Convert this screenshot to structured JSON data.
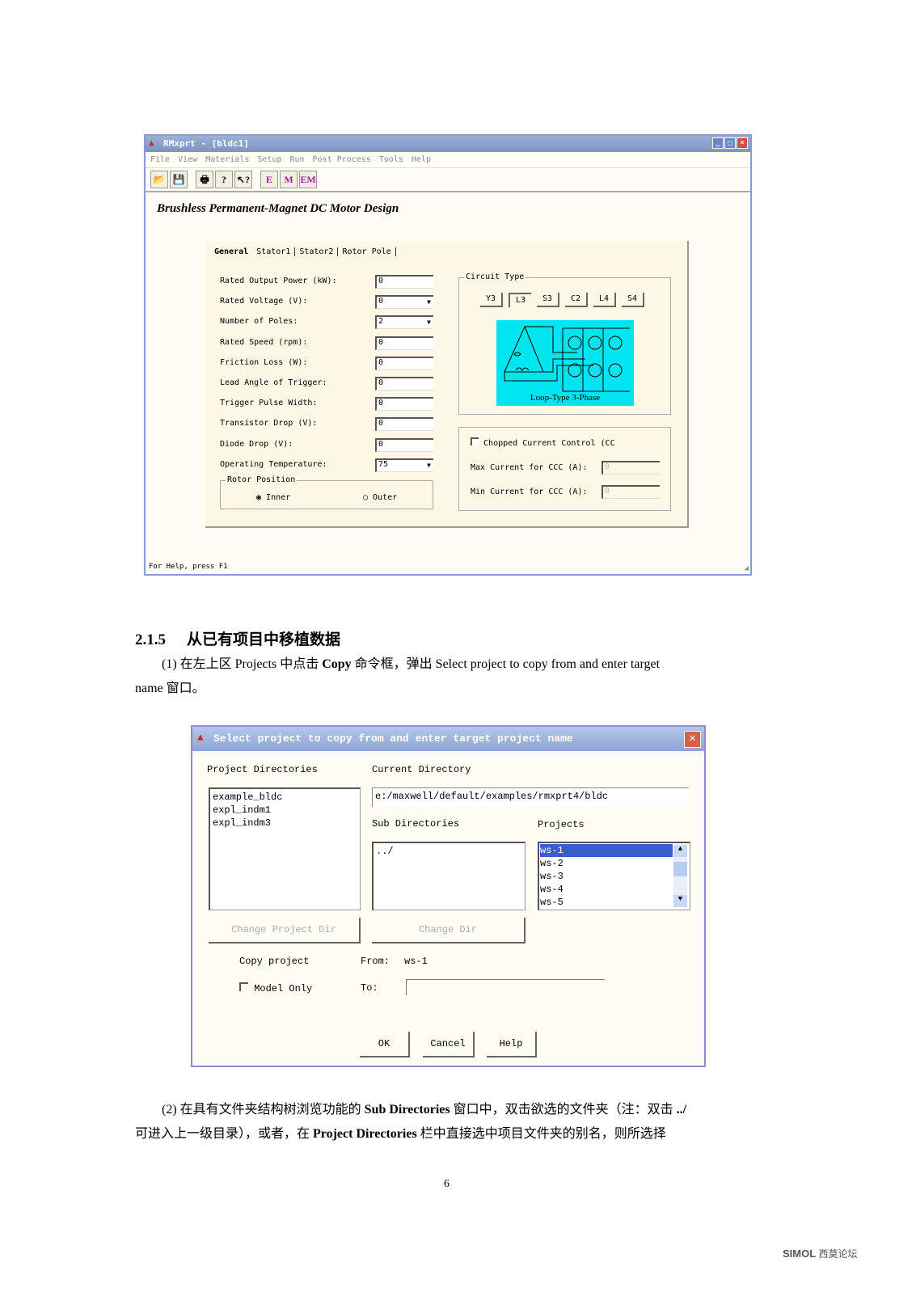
{
  "window1": {
    "title": "RMxprt - [bldc1]",
    "menu": [
      "File",
      "View",
      "Materials",
      "Setup",
      "Run",
      "Post Process",
      "Tools",
      "Help"
    ],
    "toolbar": [
      {
        "icon": "open-icon",
        "g": "📂"
      },
      {
        "icon": "save-icon",
        "g": "💾"
      },
      {
        "icon": "print-icon",
        "g": "🖶"
      },
      {
        "icon": "help-icon",
        "g": "?"
      },
      {
        "icon": "context-help-icon",
        "g": "↖?"
      },
      {
        "icon": "E",
        "g": "E"
      },
      {
        "icon": "M",
        "g": "M"
      },
      {
        "icon": "EM",
        "g": "EM"
      }
    ],
    "heading": "Brushless Permanent-Magnet DC Motor Design",
    "tabs": [
      "General",
      "Stator1",
      "Stator2",
      "Rotor Pole"
    ],
    "fields": [
      {
        "label": "Rated Output Power (kW):",
        "value": "0",
        "dropdown": false
      },
      {
        "label": "Rated Voltage (V):",
        "value": "0",
        "dropdown": true
      },
      {
        "label": "Number of Poles:",
        "value": "2",
        "dropdown": true
      },
      {
        "label": "Rated Speed (rpm):",
        "value": "0",
        "dropdown": false
      },
      {
        "label": "Friction  Loss (W):",
        "value": "0",
        "dropdown": false
      },
      {
        "label": "Lead Angle of Trigger:",
        "value": "0",
        "dropdown": false
      },
      {
        "label": "Trigger Pulse Width:",
        "value": "0",
        "dropdown": false
      },
      {
        "label": "Transistor Drop (V):",
        "value": "0",
        "dropdown": false
      },
      {
        "label": "Diode Drop (V):",
        "value": "0",
        "dropdown": false
      },
      {
        "label": "Operating Temperature:",
        "value": "75",
        "dropdown": true
      }
    ],
    "rotor_position": {
      "label": "Rotor Position",
      "options": [
        "Inner",
        "Outer"
      ],
      "selected": "Inner"
    },
    "circuit_type": {
      "label": "Circuit Type",
      "buttons": [
        "Y3",
        "L3",
        "S3",
        "C2",
        "L4",
        "S4"
      ],
      "selected": "L3",
      "caption": "Loop-Type 3-Phase",
      "color": "#00e5f0"
    },
    "ccc": {
      "checkbox": "Chopped Current Control (CC",
      "checked": false,
      "max_label": "Max Current for CCC (A):",
      "max_value": "0",
      "min_label": "Min Current for CCC (A):",
      "min_value": "0"
    },
    "status": "For Help, press F1"
  },
  "section": {
    "number": "2.1.5",
    "title": "从已有项目中移植数据"
  },
  "para1": {
    "a": "(1) 在左上区 Projects 中点击 ",
    "b": "Copy",
    "c": " 命令框，弹出 Select project to copy from and enter target",
    "d": "name 窗口。"
  },
  "window2": {
    "title": "Select project to copy from and enter target project name",
    "project_dirs_label": "Project Directories",
    "project_dirs": [
      "example_bldc",
      "expl_indm1",
      "expl_indm3"
    ],
    "current_dir_label": "Current Directory",
    "current_dir": "e:/maxwell/default/examples/rmxprt4/bldc",
    "sub_dirs_label": "Sub Directories",
    "sub_dirs": [
      "../"
    ],
    "projects_label": "Projects",
    "projects": [
      "ws-1",
      "ws-2",
      "ws-3",
      "ws-4",
      "ws-5"
    ],
    "selected_project": "ws-1",
    "change_project_dir": "Change Project Dir",
    "change_dir": "Change Dir",
    "copy_project": "Copy project",
    "from_label": "From:",
    "from_value": "ws-1",
    "model_only": "Model Only",
    "to_label": "To:",
    "to_value": "",
    "ok": "OK",
    "cancel": "Cancel",
    "help": "Help"
  },
  "para2": {
    "a": "(2) 在具有文件夹结构树浏览功能的 ",
    "b": "Sub Directories",
    "c": " 窗口中，双击欲选的文件夹（注：双击 ",
    "d": "../",
    "e": "可进入上一级目录），或者，在 ",
    "f": "Project Directories",
    "g": " 栏中直接选中项目文件夹的别名，则所选择"
  },
  "page_number": "6",
  "watermark": "simol 西莫论坛"
}
